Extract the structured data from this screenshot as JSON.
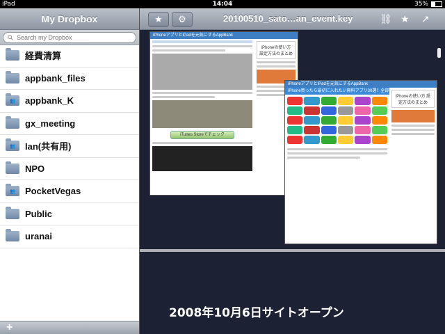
{
  "status_bar": {
    "device": "iPad",
    "time": "14:04",
    "battery": "35%",
    "battery_level": 0.35
  },
  "sidebar": {
    "title": "My Dropbox",
    "search_placeholder": "Search my Dropbox",
    "items": [
      {
        "label": "経費清算",
        "shared": false
      },
      {
        "label": "appbank_files",
        "shared": false
      },
      {
        "label": "appbank_K",
        "shared": true
      },
      {
        "label": "gx_meeting",
        "shared": false
      },
      {
        "label": "Ian(共有用)",
        "shared": true
      },
      {
        "label": "NPO",
        "shared": false
      },
      {
        "label": "PocketVegas",
        "shared": true
      },
      {
        "label": "Public",
        "shared": false
      },
      {
        "label": "uranai",
        "shared": false
      }
    ]
  },
  "toolbar": {
    "doc_title": "20100510_sato…an_event.key"
  },
  "slide": {
    "caption": "2008年10月6日サイトオープン",
    "shot1_banner": "iPhoneアプリとiPadを元気にするAppBank",
    "shot1_green_button": "iTunes Storeでチェック",
    "shot1_sidebox": "iPhoneの使い方 設定方法のまとめ",
    "shot2_banner": "iPhoneアプリとiPadを元気にするAppBank",
    "shot2_subtitle": "iPhone買ったら最初に入れたい無料アプリ30選！全部DLだ！",
    "shot2_sidebox": "iPhoneの使い方 設定方法のまとめ"
  }
}
